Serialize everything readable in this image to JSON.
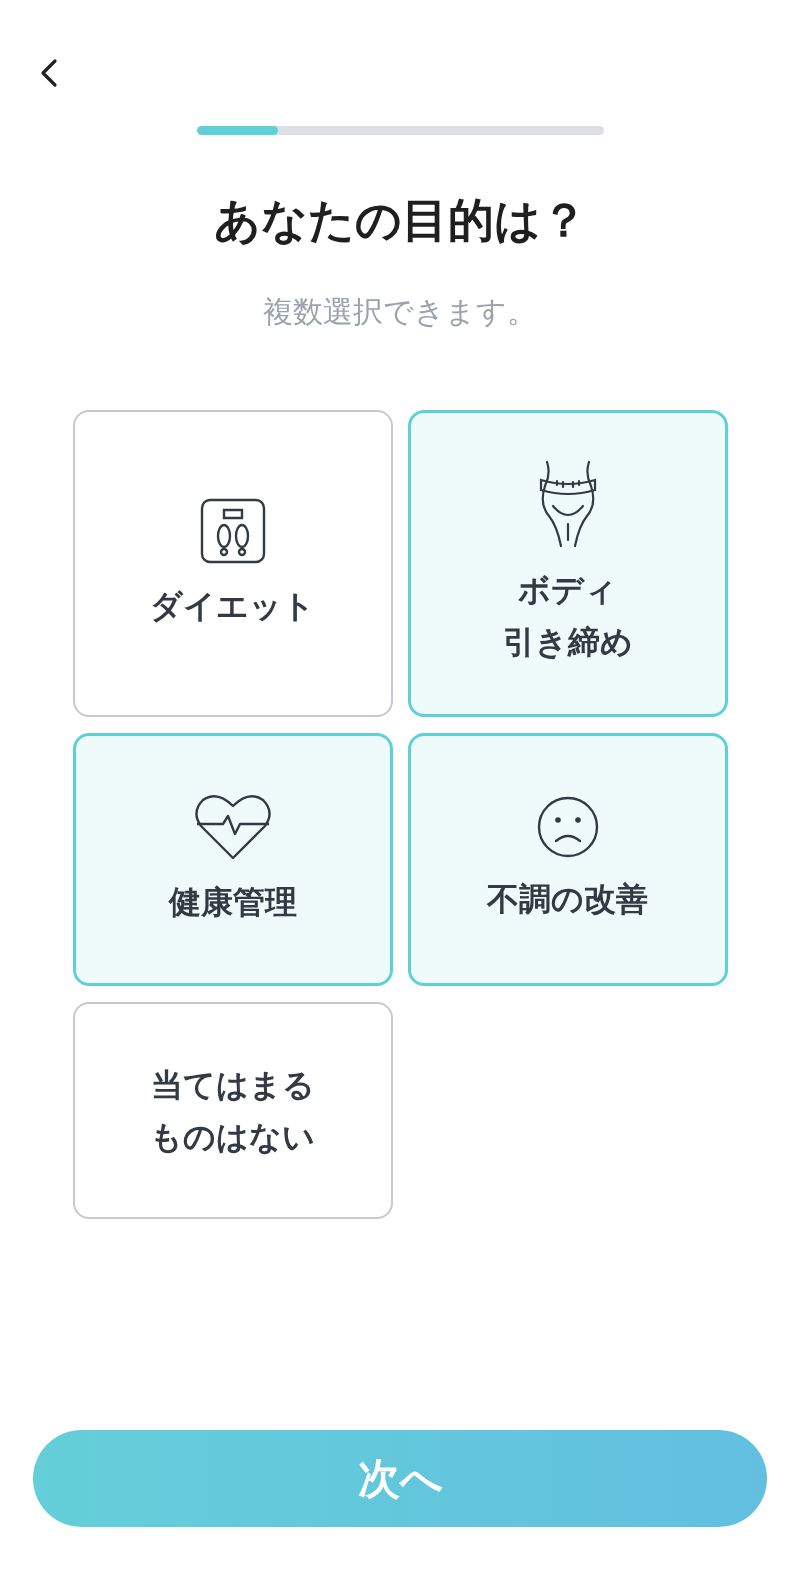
{
  "progress": {
    "level": 0.2
  },
  "title": "あなたの目的は？",
  "subtitle": "複数選択できます。",
  "options": [
    {
      "lines": [
        "ダイエット"
      ],
      "kind": "scale",
      "selected": false
    },
    {
      "lines": [
        "ボディ",
        "引き締め"
      ],
      "kind": "body",
      "selected": true
    },
    {
      "lines": [
        "健康管理"
      ],
      "kind": "heart",
      "selected": true
    },
    {
      "lines": [
        "不調の改善"
      ],
      "kind": "face",
      "selected": true
    },
    {
      "lines": [
        "当てはまる",
        "ものはない"
      ],
      "kind": "none",
      "selected": false
    }
  ],
  "next_button": {
    "label": "次へ"
  }
}
